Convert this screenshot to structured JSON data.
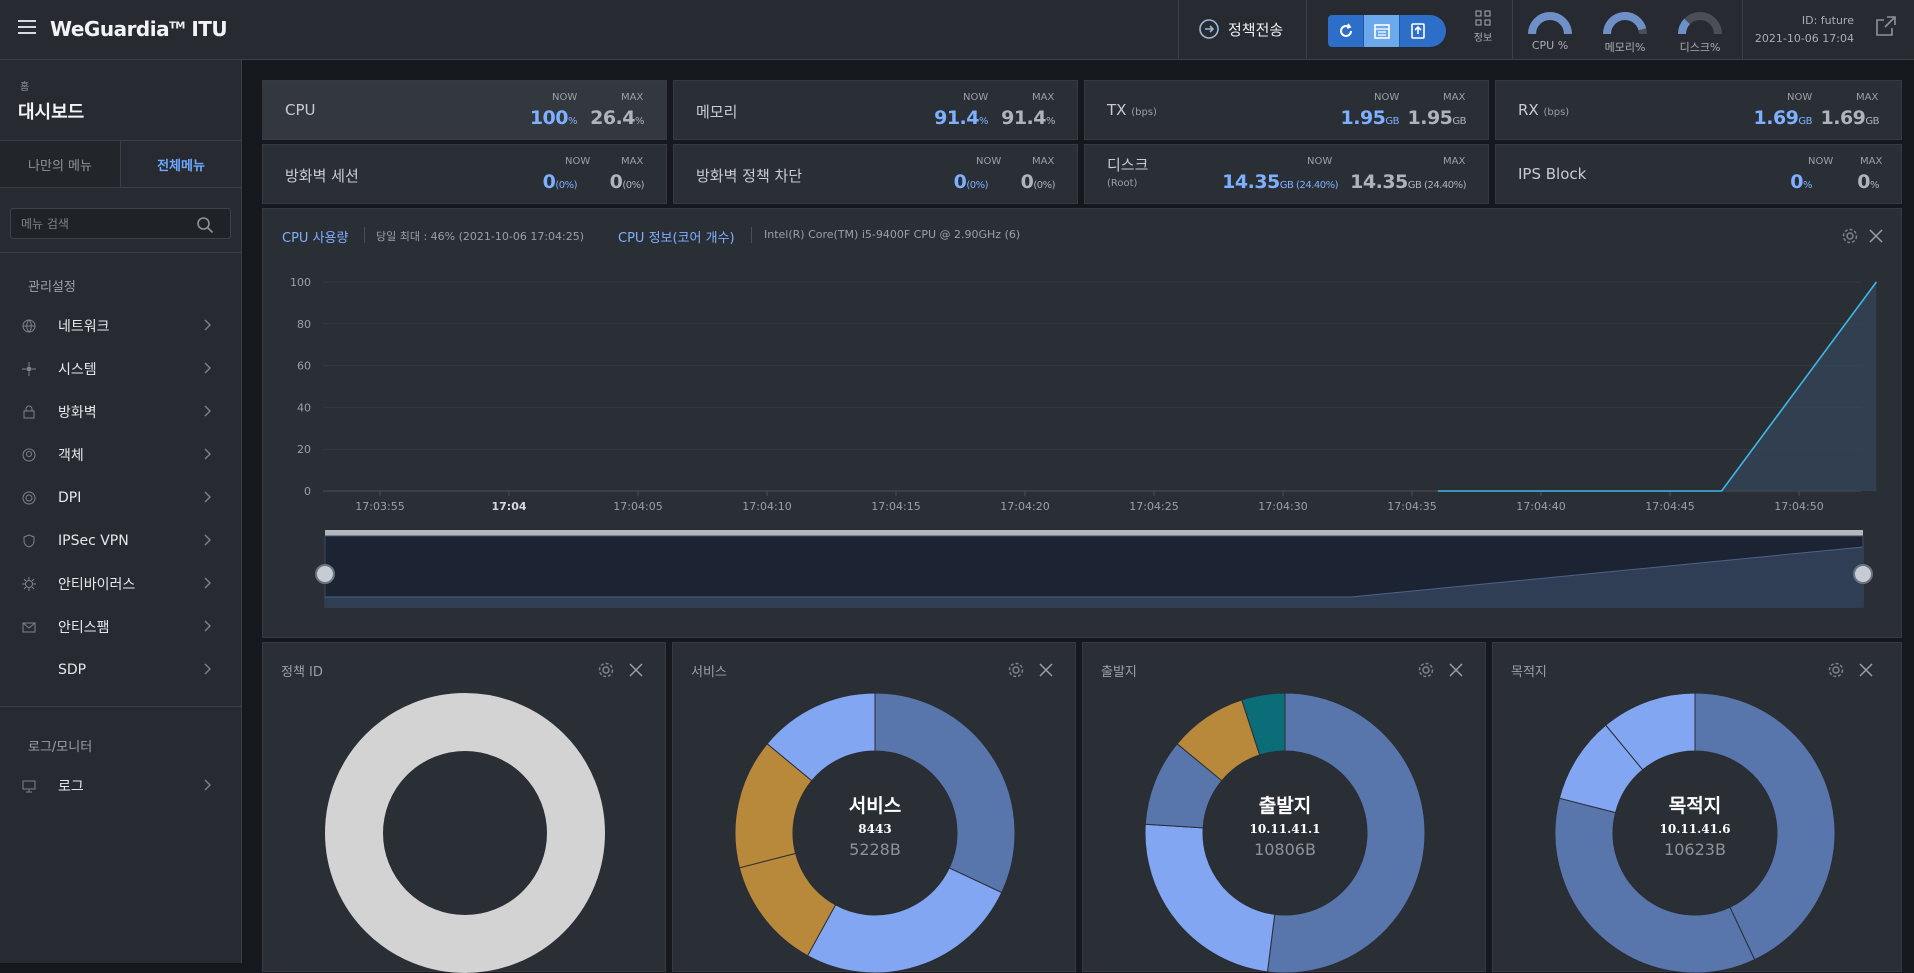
{
  "app": {
    "brand": "WeGuardia",
    "brand_tm": "TM",
    "brand_suffix": "ITU"
  },
  "topbar": {
    "policy_label": "정책전송",
    "toolbar_buttons": [
      "refresh-icon",
      "calendar-icon",
      "upload-icon"
    ],
    "info_label": "정보",
    "gauges": [
      {
        "label": "CPU %",
        "value": 100
      },
      {
        "label": "메모리%",
        "value": 91.4
      },
      {
        "label": "디스크%",
        "value": 24.4
      }
    ],
    "user_id": "ID: future",
    "datetime": "2021-10-06 17:04"
  },
  "sidebar": {
    "breadcrumb": "홈",
    "page_title": "대시보드",
    "tab_my": "나만의 메뉴",
    "tab_all": "전체메뉴",
    "search_placeholder": "메뉴 검색",
    "group1": "관리설정",
    "items": [
      {
        "label": "네트워크",
        "icon": "globe-icon"
      },
      {
        "label": "시스템",
        "icon": "system-icon"
      },
      {
        "label": "방화벽",
        "icon": "lock-icon"
      },
      {
        "label": "객체",
        "icon": "object-icon"
      },
      {
        "label": "DPI",
        "icon": "dpi-icon"
      },
      {
        "label": "IPSec VPN",
        "icon": "shield-icon"
      },
      {
        "label": "안티바이러스",
        "icon": "virus-icon"
      },
      {
        "label": "안티스팸",
        "icon": "mail-icon"
      },
      {
        "label": "SDP",
        "icon": ""
      }
    ],
    "group2": "로그/모니터",
    "log_item": {
      "label": "로그",
      "icon": "monitor-icon"
    }
  },
  "stats": {
    "now_label": "NOW",
    "max_label": "MAX",
    "cpu": {
      "label": "CPU",
      "now": "100",
      "now_unit": "%",
      "max": "26.4",
      "max_unit": "%"
    },
    "mem": {
      "label": "메모리",
      "now": "91.4",
      "now_unit": "%",
      "max": "91.4",
      "max_unit": "%"
    },
    "tx": {
      "label": "TX",
      "sub": "(bps)",
      "now": "1.95",
      "now_unit": "GB",
      "max": "1.95",
      "max_unit": "GB"
    },
    "rx": {
      "label": "RX",
      "sub": "(bps)",
      "now": "1.69",
      "now_unit": "GB",
      "max": "1.69",
      "max_unit": "GB"
    },
    "fw_session": {
      "label": "방화벽 세션",
      "now": "0",
      "now_unit": "(0%)",
      "max": "0",
      "max_unit": "(0%)"
    },
    "fw_block": {
      "label": "방화벽 정책 차단",
      "now": "0",
      "now_unit": "(0%)",
      "max": "0",
      "max_unit": "(0%)"
    },
    "disk": {
      "label": "디스크",
      "sub": "(Root)",
      "now": "14.35",
      "now_unit": "GB (24.40%)",
      "max": "14.35",
      "max_unit": "GB (24.40%)"
    },
    "ips": {
      "label": "IPS Block",
      "now": "0",
      "now_unit": "%",
      "max": "0",
      "max_unit": "%"
    }
  },
  "cpu_panel": {
    "title": "CPU 사용량",
    "daily_max": "당일 최대 : 46% (2021-10-06 17:04:25)",
    "info_title": "CPU 정보(코어 개수)",
    "cpu_model": "Intel(R) Core(TM) i5-9400F CPU @ 2.90GHz (6)"
  },
  "chart_data": {
    "type": "area",
    "title": "CPU 사용량",
    "ylim": [
      0,
      100
    ],
    "yticks": [
      "0",
      "20",
      "40",
      "60",
      "80",
      "100"
    ],
    "xticks": [
      "17:03:55",
      "17:04",
      "17:04:05",
      "17:04:10",
      "17:04:15",
      "17:04:20",
      "17:04:25",
      "17:04:30",
      "17:04:35",
      "17:04:40",
      "17:04:45",
      "17:04:50"
    ],
    "series": [
      {
        "x": [
          "17:04:36",
          "17:04:47",
          "17:04:53"
        ],
        "values": [
          0,
          0,
          100
        ]
      }
    ],
    "line_color": "#3fb6e6",
    "grid": true
  },
  "donuts": [
    {
      "title": "정책 ID",
      "center_title": "",
      "center_value": "",
      "center_size": "",
      "segments": [
        {
          "value": 100,
          "color": "#d3d3d3"
        }
      ]
    },
    {
      "title": "서비스",
      "center_title": "서비스",
      "center_value": "8443",
      "center_size": "5228B",
      "segments": [
        {
          "value": 32,
          "color": "#5876ab"
        },
        {
          "value": 26,
          "color": "#82a6f1"
        },
        {
          "value": 13,
          "color": "#b8893a"
        },
        {
          "value": 15,
          "color": "#b8893a"
        },
        {
          "value": 14,
          "color": "#82a6f1"
        }
      ]
    },
    {
      "title": "출발지",
      "center_title": "출발지",
      "center_value": "10.11.41.1",
      "center_size": "10806B",
      "segments": [
        {
          "value": 52,
          "color": "#5876ab"
        },
        {
          "value": 24,
          "color": "#82a6f1"
        },
        {
          "value": 10,
          "color": "#5876ab"
        },
        {
          "value": 9,
          "color": "#b8893a"
        },
        {
          "value": 5,
          "color": "#0a6d78"
        }
      ]
    },
    {
      "title": "목적지",
      "center_title": "목적지",
      "center_value": "10.11.41.6",
      "center_size": "10623B",
      "segments": [
        {
          "value": 43,
          "color": "#5876ab"
        },
        {
          "value": 36,
          "color": "#5876ab"
        },
        {
          "value": 10,
          "color": "#82a6f1"
        },
        {
          "value": 11,
          "color": "#82a6f1"
        }
      ]
    }
  ]
}
